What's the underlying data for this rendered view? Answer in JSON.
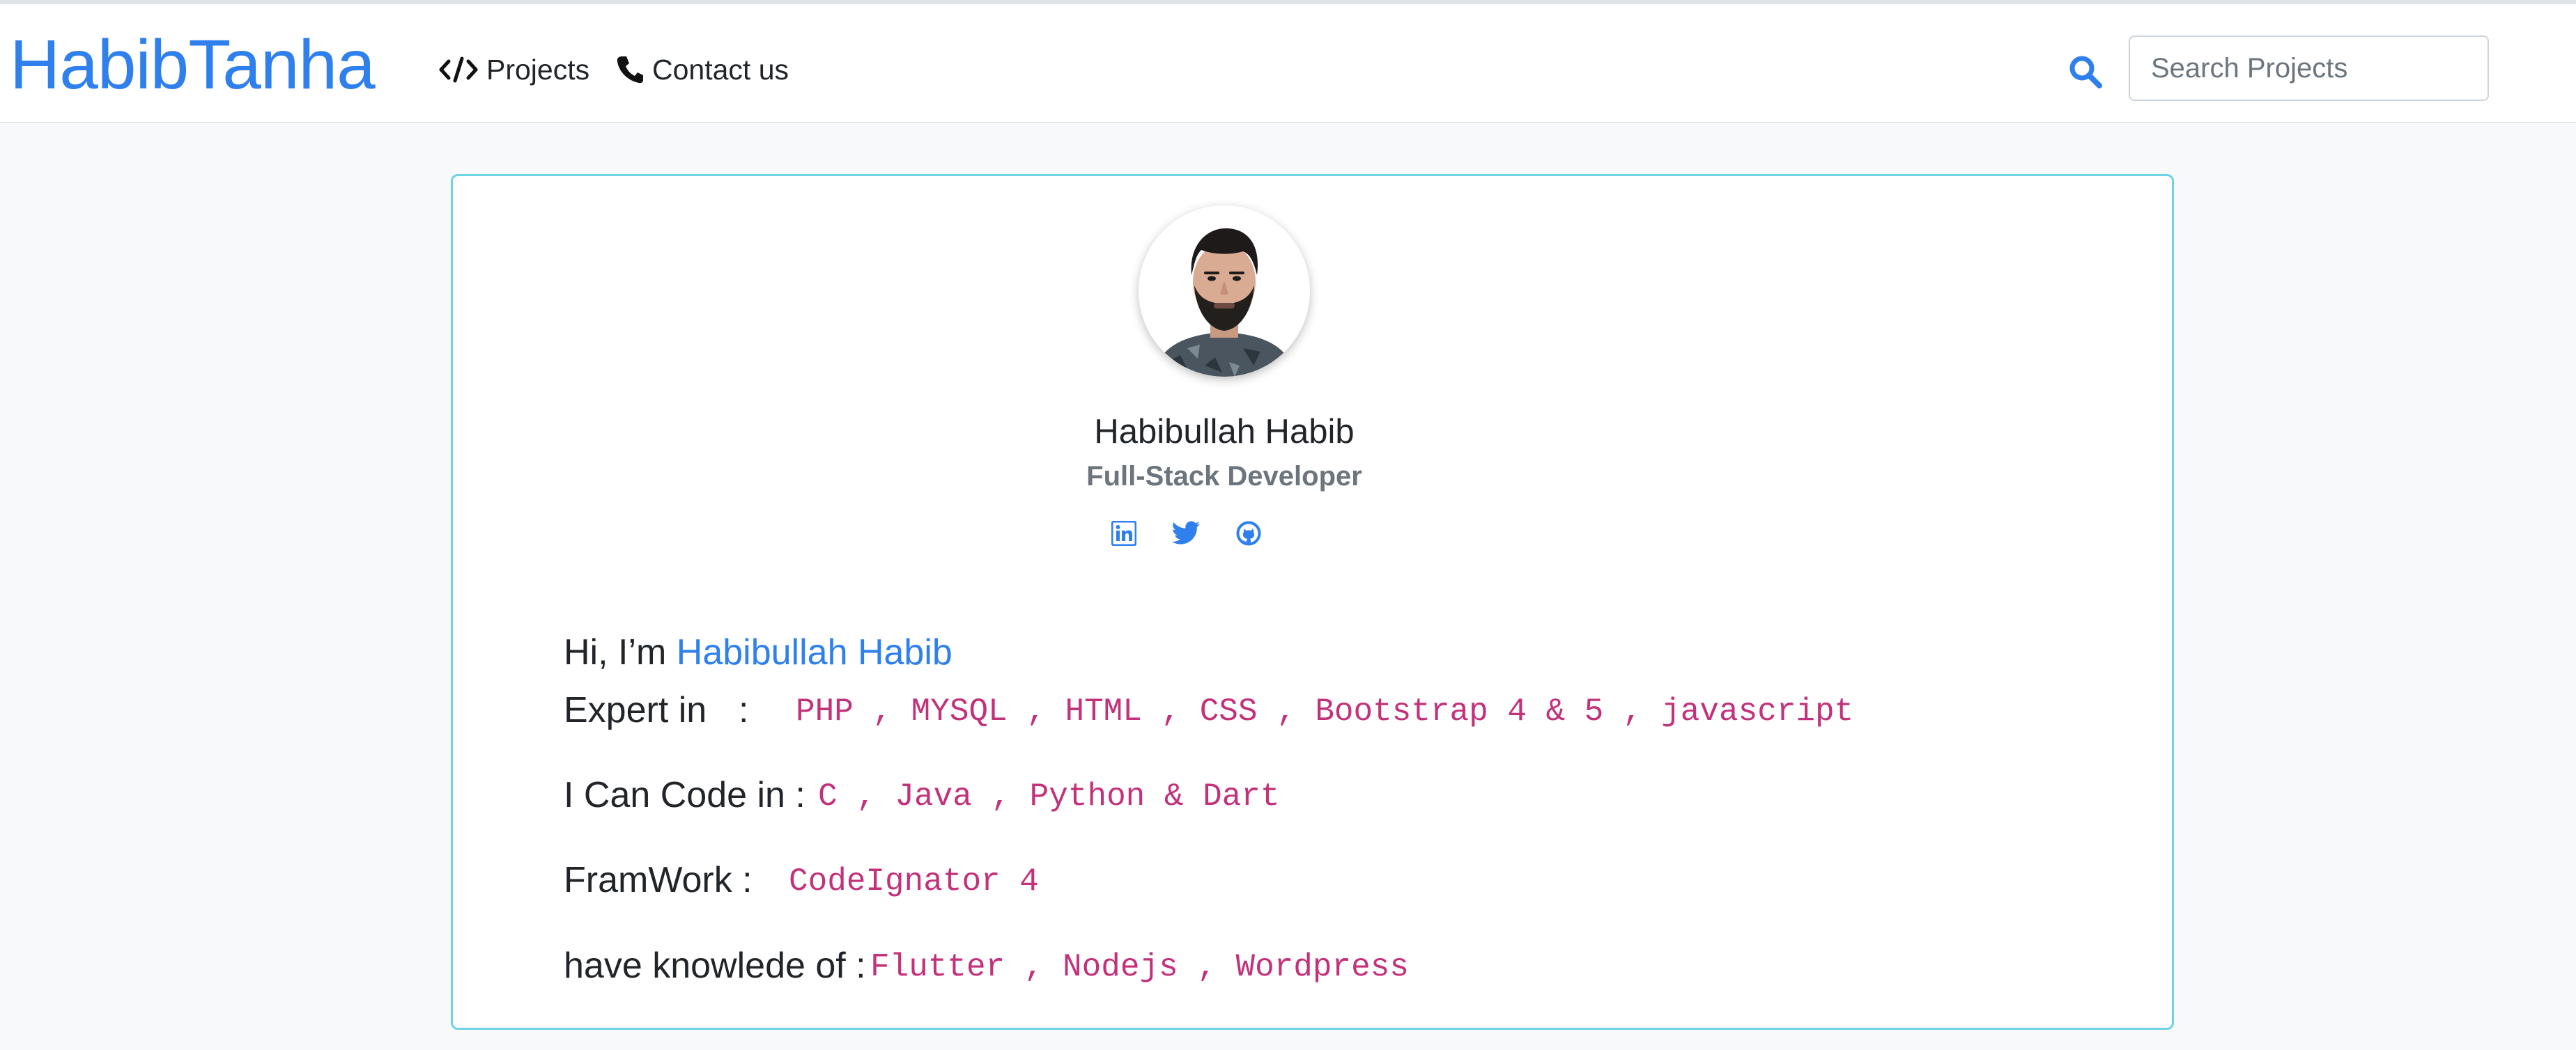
{
  "navbar": {
    "brand": "HabibTanha",
    "items": [
      {
        "label": "Projects",
        "icon": "code-icon"
      },
      {
        "label": "Contact us",
        "icon": "phone-icon"
      }
    ],
    "search": {
      "placeholder": "Search Projects",
      "value": "",
      "icon": "search-icon"
    }
  },
  "profile": {
    "name": "Habibullah Habib",
    "role": "Full-Stack Developer",
    "avatar_alt": "Profile photo",
    "social": [
      "linkedin-icon",
      "twitter-icon",
      "github-icon"
    ]
  },
  "about": {
    "greeting_prefix": "Hi, I’m ",
    "greeting_name": "Habibullah Habib",
    "expert_label": "Expert in",
    "expert_colon": ":",
    "expert_values": "PHP , MYSQL , HTML , CSS , Bootstrap 4 & 5 , javascript",
    "code_label": "I Can Code in :",
    "code_values": "C , Java , Python & Dart",
    "framework_label": "FramWork :",
    "framework_values": "CodeIgnator 4",
    "knowledge_label": "have knowlede of :",
    "knowledge_values": "Flutter , Nodejs , Wordpress"
  },
  "colors": {
    "brand": "#2f80ed",
    "code_text": "#c3317a",
    "card_border": "#6fd3e6",
    "page_bg": "#f8f9fa"
  }
}
